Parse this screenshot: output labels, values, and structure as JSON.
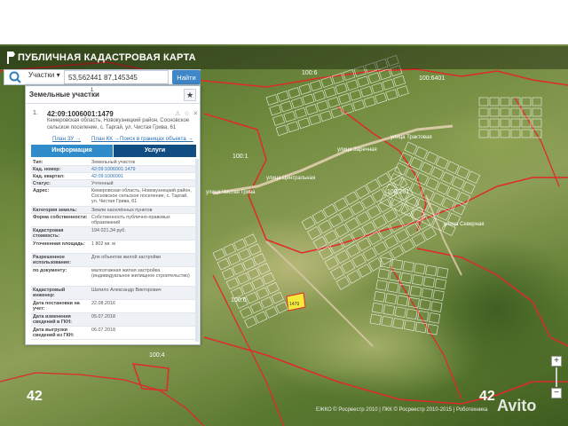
{
  "app": {
    "title": "ПУБЛИЧНАЯ КАДАСТРОВАЯ КАРТА"
  },
  "search": {
    "type_label": "Участки",
    "query": "53,562441 87,145345",
    "find_label": "Найти"
  },
  "panel": {
    "title": "Земельные участки",
    "count": "1",
    "result": {
      "index": "1.",
      "cad_number": "42:09:1006001:1479",
      "address": "Кемеровская область, Новокузнецкий район, Сосновское сельское поселение, с. Таргай, ул. Чистая Грива, 61",
      "links": [
        "План ЗУ →",
        "План КК →",
        "Поиск в границах объекта →"
      ]
    },
    "tabs": [
      "Информация",
      "Услуги"
    ],
    "rows": [
      {
        "k": "Тип:",
        "v": "Земельный участок"
      },
      {
        "k": "Кад. номер:",
        "v": "42:09:1006001:1479"
      },
      {
        "k": "Кад. квартал:",
        "v": "42:09:1006001"
      },
      {
        "k": "Статус:",
        "v": "Учтенный"
      },
      {
        "k": "Адрес:",
        "v": "Кемеровская область, Новокузнецкий район, Сосновское сельское поселение, с. Таргай, ул. Чистая Грива, 61"
      },
      {
        "k": "Категория земель:",
        "v": "Земли населённых пунктов"
      },
      {
        "k": "Форма собственности:",
        "v": "Собственность публично-правовых образований"
      },
      {
        "k": "Кадастровая стоимость:",
        "v": "194 021,34 руб."
      },
      {
        "k": "Уточненная площадь:",
        "v": "1 802 кв. м"
      },
      {
        "k": "Разрешенное использование:",
        "v": "Для объектов жилой застройки"
      },
      {
        "k": "по документу:",
        "v": "малоэтажная жилая застройка (индивидуальное жилищное строительство)"
      },
      {
        "k": "Кадастровый инженер:",
        "v": "Шатило Александр Викторович"
      },
      {
        "k": "Дата постановки на учет:",
        "v": "22.08.2016"
      },
      {
        "k": "Дата изменения сведений в ГКН:",
        "v": "05.07.2018"
      },
      {
        "k": "Дата выгрузки сведений из ГКН:",
        "v": "06.07.2018"
      }
    ]
  },
  "map": {
    "labels": [
      "100:6",
      "100:6401",
      "100:1",
      "100:201",
      "100:4",
      "100:6",
      "улица Чистая Грива",
      "улица Центральная",
      "улица Трактовая",
      "улица Северная",
      "улица Заречная"
    ],
    "zone_labels": [
      "42",
      "42"
    ],
    "selected_parcel_label": "1479",
    "copyright": "ЕЖКО © Росреестр 2010 | ПКК © Росреестр 2010-2015 | Роботехника",
    "watermark": "Avito"
  },
  "colors": {
    "accent": "#2f8bc9",
    "tab_dark": "#0f4d83",
    "boundary": "#e02a2a",
    "selected": "#f3ea3a"
  }
}
